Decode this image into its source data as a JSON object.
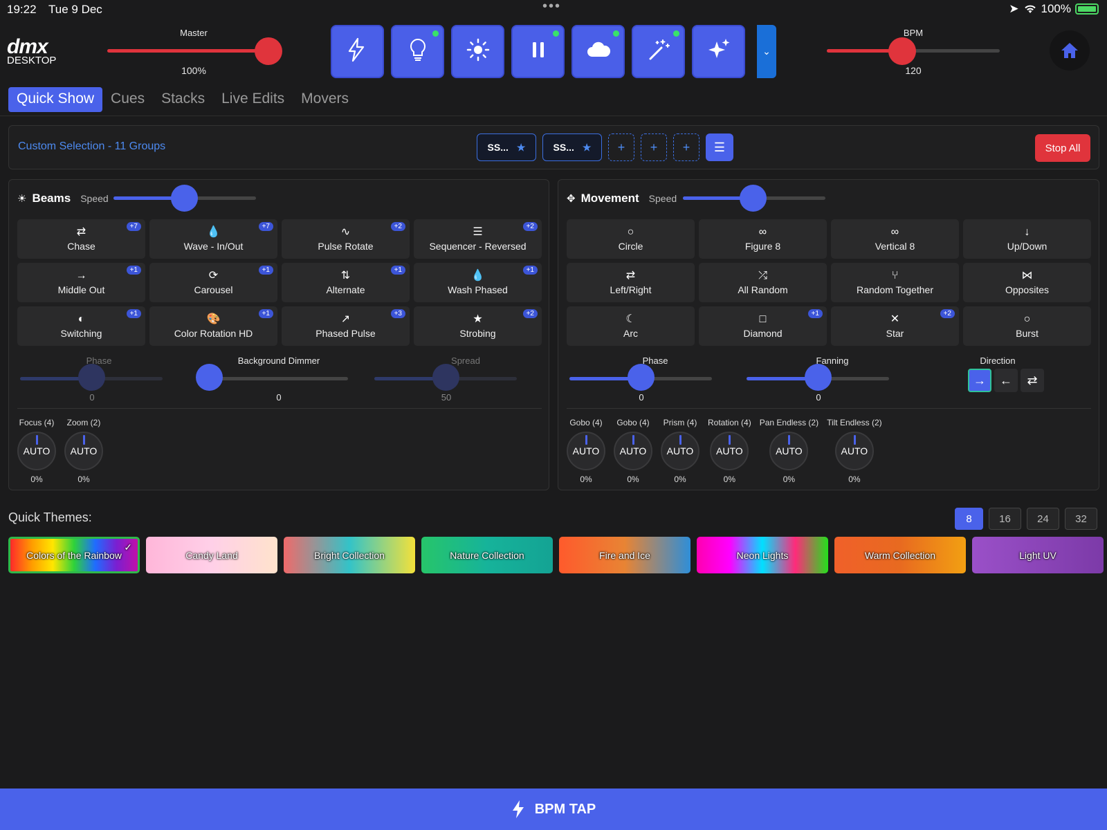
{
  "status": {
    "time": "19:22",
    "date": "Tue 9 Dec",
    "battery": "100%"
  },
  "logo": {
    "top": "dmx",
    "bottom": "DESKTOP"
  },
  "master": {
    "label": "Master",
    "value": "100%",
    "level": 1.0
  },
  "bpm": {
    "label": "BPM",
    "value": "120",
    "level": 0.44
  },
  "top_buttons": [
    {
      "icon": "lightning-icon",
      "active_dot": false
    },
    {
      "icon": "bulb-icon",
      "active_dot": true
    },
    {
      "icon": "sun-icon",
      "active_dot": false
    },
    {
      "icon": "pause-icon",
      "active_dot": true
    },
    {
      "icon": "cloud-icon",
      "active_dot": true
    },
    {
      "icon": "magic-wand-icon",
      "active_dot": true
    },
    {
      "icon": "sparkles-icon",
      "active_dot": false
    }
  ],
  "tabs": [
    "Quick Show",
    "Cues",
    "Stacks",
    "Live Edits",
    "Movers"
  ],
  "selection": {
    "title": "Custom Selection - 11 Groups",
    "chips": [
      "SS...",
      "SS..."
    ],
    "add_chips": [
      "+",
      "+",
      "+"
    ],
    "stop_all": "Stop All"
  },
  "beams": {
    "title": "Beams",
    "speed_label": "Speed",
    "speed_level": 0.5,
    "effects": [
      {
        "label": "Chase",
        "icon": "⇄",
        "badge": "+7"
      },
      {
        "label": "Wave - In/Out",
        "icon": "💧",
        "badge": "+7"
      },
      {
        "label": "Pulse Rotate",
        "icon": "∿",
        "badge": "+2"
      },
      {
        "label": "Sequencer - Reversed",
        "icon": "☰",
        "badge": "+2"
      },
      {
        "label": "Middle Out",
        "icon": "→",
        "badge": "+1"
      },
      {
        "label": "Carousel",
        "icon": "⟳",
        "badge": "+1"
      },
      {
        "label": "Alternate",
        "icon": "⇅",
        "badge": "+1"
      },
      {
        "label": "Wash Phased",
        "icon": "💧",
        "badge": "+1"
      },
      {
        "label": "Switching",
        "icon": "◐",
        "badge": "+1"
      },
      {
        "label": "Color Rotation HD",
        "icon": "🎨",
        "badge": "+1"
      },
      {
        "label": "Phased Pulse",
        "icon": "↗",
        "badge": "+3"
      },
      {
        "label": "Strobing",
        "icon": "★",
        "badge": "+2"
      }
    ],
    "sliders": [
      {
        "label": "Phase",
        "value": "0",
        "level": 0.5,
        "dim": true
      },
      {
        "label": "Background Dimmer",
        "value": "0",
        "level": 0.0,
        "dim": false
      },
      {
        "label": "Spread",
        "value": "50",
        "level": 0.5,
        "dim": true
      }
    ],
    "knobs": [
      {
        "label": "Focus (4)",
        "text": "AUTO",
        "value": "0%"
      },
      {
        "label": "Zoom (2)",
        "text": "AUTO",
        "value": "0%"
      }
    ]
  },
  "movement": {
    "title": "Movement",
    "speed_label": "Speed",
    "speed_level": 0.5,
    "effects": [
      {
        "label": "Circle",
        "icon": "○",
        "badge": ""
      },
      {
        "label": "Figure 8",
        "icon": "∞",
        "badge": ""
      },
      {
        "label": "Vertical 8",
        "icon": "∞",
        "badge": ""
      },
      {
        "label": "Up/Down",
        "icon": "↓",
        "badge": ""
      },
      {
        "label": "Left/Right",
        "icon": "⇄",
        "badge": ""
      },
      {
        "label": "All Random",
        "icon": "⤮",
        "badge": ""
      },
      {
        "label": "Random Together",
        "icon": "⑂",
        "badge": ""
      },
      {
        "label": "Opposites",
        "icon": "⋈",
        "badge": ""
      },
      {
        "label": "Arc",
        "icon": "☾",
        "badge": ""
      },
      {
        "label": "Diamond",
        "icon": "□",
        "badge": "+1"
      },
      {
        "label": "Star",
        "icon": "✕",
        "badge": "+2"
      },
      {
        "label": "Burst",
        "icon": "○",
        "badge": ""
      }
    ],
    "sliders": [
      {
        "label": "Phase",
        "value": "0",
        "level": 0.5
      },
      {
        "label": "Fanning",
        "value": "0",
        "level": 0.5
      }
    ],
    "direction": {
      "label": "Direction",
      "buttons": [
        "→",
        "←",
        "⇄"
      ]
    },
    "knobs": [
      {
        "label": "Gobo (4)",
        "text": "AUTO",
        "value": "0%"
      },
      {
        "label": "Gobo (4)",
        "text": "AUTO",
        "value": "0%"
      },
      {
        "label": "Prism (4)",
        "text": "AUTO",
        "value": "0%"
      },
      {
        "label": "Rotation (4)",
        "text": "AUTO",
        "value": "0%"
      },
      {
        "label": "Pan Endless (2)",
        "text": "AUTO",
        "value": "0%"
      },
      {
        "label": "Tilt Endless (2)",
        "text": "AUTO",
        "value": "0%"
      }
    ]
  },
  "quick_themes": {
    "title": "Quick Themes:",
    "pages": [
      "8",
      "16",
      "24",
      "32"
    ],
    "themes": [
      {
        "label": "Colors of the Rainbow",
        "selected": true
      },
      {
        "label": "Candy Land",
        "selected": false
      },
      {
        "label": "Bright Collection",
        "selected": false
      },
      {
        "label": "Nature Collection",
        "selected": false
      },
      {
        "label": "Fire and Ice",
        "selected": false
      },
      {
        "label": "Neon Lights",
        "selected": false
      },
      {
        "label": "Warm Collection",
        "selected": false
      },
      {
        "label": "Light UV",
        "selected": false
      }
    ]
  },
  "bpm_tap": {
    "label": "BPM TAP"
  },
  "colors": {
    "accent": "#4a62ea",
    "stop": "#e0343c",
    "slider_red": "#e0343c",
    "active_dot": "#39e26a"
  }
}
